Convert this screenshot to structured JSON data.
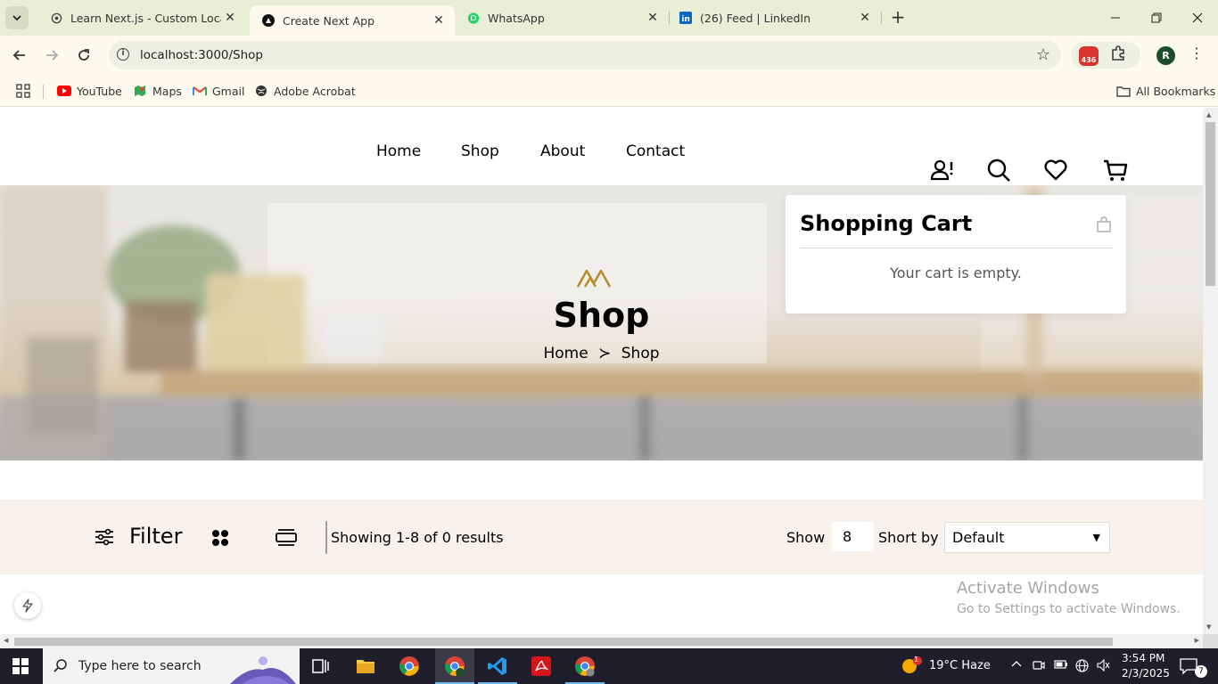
{
  "browser": {
    "tabs": [
      {
        "title": "Learn Next.js - Custom Localho",
        "icon": "nextjs-icon",
        "active": false
      },
      {
        "title": "Create Next App",
        "icon": "nextjs-icon",
        "active": true
      },
      {
        "title": "WhatsApp",
        "icon": "whatsapp-icon",
        "active": false
      },
      {
        "title": "(26) Feed | LinkedIn",
        "icon": "linkedin-icon",
        "active": false
      }
    ],
    "url": "localhost:3000/Shop",
    "profile_initial": "R",
    "extension_badge": "436",
    "bookmarks": [
      "YouTube",
      "Maps",
      "Gmail",
      "Adobe Acrobat"
    ],
    "all_bookmarks": "All Bookmarks"
  },
  "site": {
    "nav": [
      "Home",
      "Shop",
      "About",
      "Contact"
    ],
    "hero": {
      "title": "Shop",
      "crumb_home": "Home",
      "crumb_sep": "≻",
      "crumb_current": "Shop"
    },
    "cart": {
      "title": "Shopping Cart",
      "empty_text": "Your cart is empty."
    },
    "filterbar": {
      "filter_label": "Filter",
      "results_text": "Showing 1-8 of 0 results",
      "show_label": "Show",
      "show_value": "8",
      "sort_label": "Short by",
      "sort_value": "Default"
    },
    "accent_color": "#b88e2f",
    "filterbar_bg": "#f9f1ec"
  },
  "watermark": {
    "line1": "Activate Windows",
    "line2": "Go to Settings to activate Windows."
  },
  "taskbar": {
    "search_placeholder": "Type here to search",
    "weather": "19°C  Haze",
    "weather_badge": "1",
    "time": "3:54 PM",
    "date": "2/3/2025",
    "notification_count": "7"
  }
}
